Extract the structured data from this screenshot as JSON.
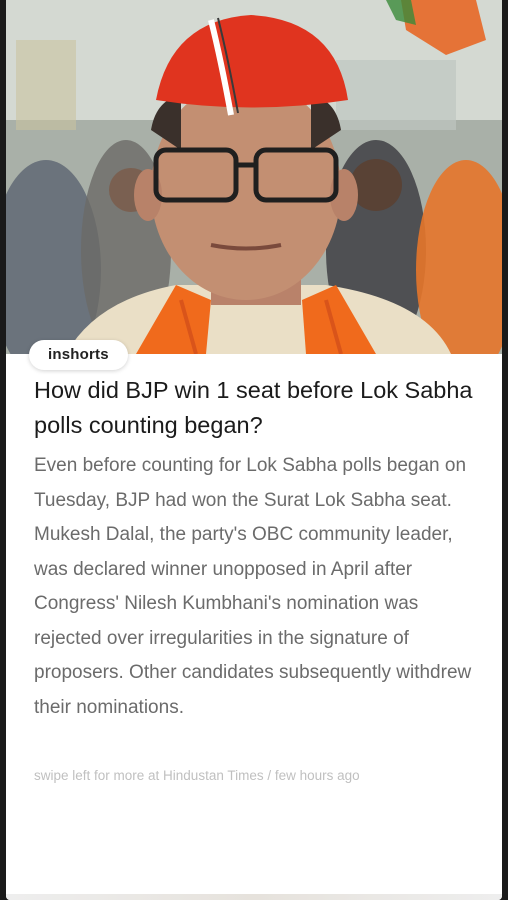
{
  "brand": {
    "badge_label": "inshorts"
  },
  "article": {
    "headline": "How did BJP win 1 seat before Lok Sabha polls counting began?",
    "body": "Even before counting for Lok Sabha polls began on Tuesday, BJP had won the Surat Lok Sabha seat. Mukesh Dalal, the party's OBC community leader, was declared winner unopposed in April after Congress' Nilesh Kumbhani's nomination was rejected over irregularities in the signature of proposers. Other candidates subsequently withdrew their nominations.",
    "footer": "swipe left for more at Hindustan Times / few hours ago"
  },
  "colors": {
    "headline": "#1b1b1b",
    "body": "#6b6b6b",
    "footer": "#c0c0c0",
    "cap": "#e0341f",
    "scarf": "#f06a1c"
  }
}
